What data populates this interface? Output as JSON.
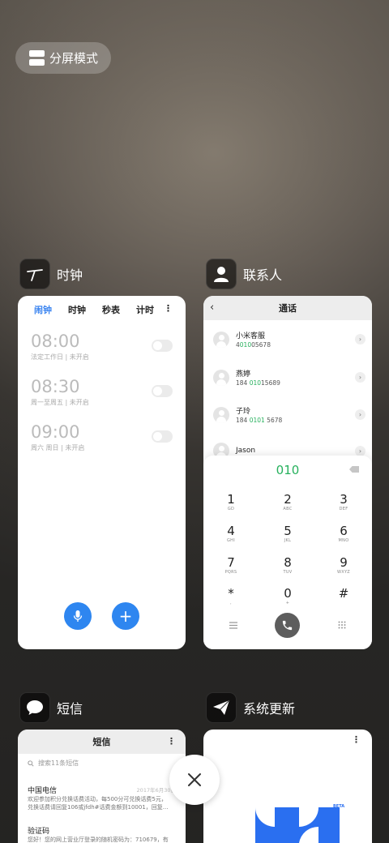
{
  "split_mode": {
    "label": "分屏模式"
  },
  "apps": {
    "clock": {
      "title": "时钟",
      "tabs": [
        "闹钟",
        "时钟",
        "秒表",
        "计时"
      ],
      "active_tab": "闹钟",
      "alarms": [
        {
          "time": "08:00",
          "desc": "法定工作日 | 未开启",
          "enabled": false
        },
        {
          "time": "08:30",
          "desc": "周一至周五 | 未开启",
          "enabled": false
        },
        {
          "time": "09:00",
          "desc": "周六 周日 | 未开启",
          "enabled": false
        }
      ]
    },
    "contacts": {
      "title": "联系人",
      "header": "通话",
      "list": [
        {
          "name": "小米客服",
          "number_pre": "4",
          "number_hl": "010",
          "number_post": "05678"
        },
        {
          "name": "燕婷",
          "number_pre": "184 ",
          "number_hl": "010",
          "number_post": "15689"
        },
        {
          "name": "子玲",
          "number_pre": "184 ",
          "number_hl": "0101",
          "number_post": " 5678"
        },
        {
          "name": "Jason",
          "number_pre": "",
          "number_hl": "",
          "number_post": ""
        }
      ],
      "dial_input": "010",
      "keys": [
        {
          "d": "1",
          "l": "GD"
        },
        {
          "d": "2",
          "l": "ABC"
        },
        {
          "d": "3",
          "l": "DEF"
        },
        {
          "d": "4",
          "l": "GHI"
        },
        {
          "d": "5",
          "l": "JKL"
        },
        {
          "d": "6",
          "l": "MNO"
        },
        {
          "d": "7",
          "l": "PQRS"
        },
        {
          "d": "8",
          "l": "TUV"
        },
        {
          "d": "9",
          "l": "WXYZ"
        },
        {
          "d": "*",
          "l": ","
        },
        {
          "d": "0",
          "l": "+"
        },
        {
          "d": "#",
          "l": ""
        }
      ]
    },
    "sms": {
      "title": "短信",
      "header": "短信",
      "search_placeholder": "搜索11条短信",
      "messages": [
        {
          "from": "中国电信",
          "date": "2017年6月30日",
          "line1": "欢迎参加积分兑换话费活动，每500分可兑换话费5元，",
          "line2": "兑换话费请回复106或jfdh#话费金额到10001，回复..."
        },
        {
          "from": "验证码",
          "date": "",
          "line1": "您好！您的网上营业厅登录的随机密码为：710679，有",
          "line2": ""
        }
      ]
    },
    "update": {
      "title": "系统更新",
      "badge": "BETA"
    }
  },
  "colors": {
    "accent_blue": "#2e86f0",
    "green": "#27b15d"
  }
}
